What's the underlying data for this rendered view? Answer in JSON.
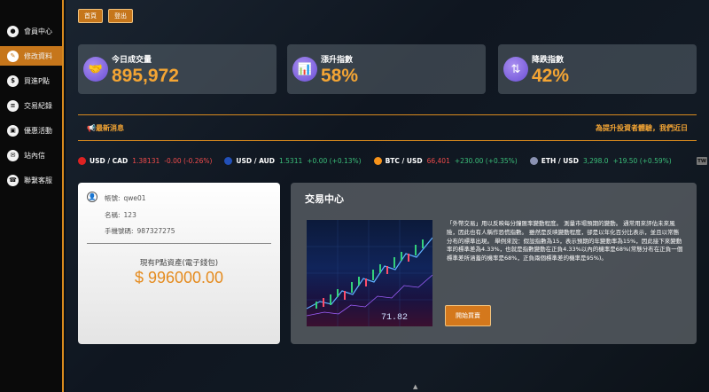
{
  "sidebar": {
    "items": [
      {
        "label": "會員中心",
        "icon": "user-icon",
        "glyph": "●",
        "active": false
      },
      {
        "label": "修改資料",
        "icon": "edit-user-icon",
        "glyph": "✎",
        "active": true
      },
      {
        "label": "買進P點",
        "icon": "dollar-icon",
        "glyph": "$",
        "active": false
      },
      {
        "label": "交易紀錄",
        "icon": "record-icon",
        "glyph": "≡",
        "active": false
      },
      {
        "label": "優惠活動",
        "icon": "gift-icon",
        "glyph": "▣",
        "active": false
      },
      {
        "label": "站內信",
        "icon": "mail-icon",
        "glyph": "✉",
        "active": false
      },
      {
        "label": "聯繫客服",
        "icon": "support-icon",
        "glyph": "☎",
        "active": false
      }
    ]
  },
  "topbar": {
    "home_label": "首頁",
    "logout_label": "登出"
  },
  "stats": [
    {
      "label": "今日成交量",
      "value": "895,972",
      "icon": "handshake-icon",
      "glyph": "🤝"
    },
    {
      "label": "漲升指數",
      "value": "58%",
      "icon": "chart-up-icon",
      "glyph": "📊"
    },
    {
      "label": "降跌指數",
      "value": "42%",
      "icon": "arrows-updown-icon",
      "glyph": "⇅"
    }
  ],
  "news": {
    "label": "📢最新消息",
    "marquee": "為提升投資者體驗，我們近日"
  },
  "ticker": [
    {
      "pair": "USD / CAD",
      "price": "1.38131",
      "change": "-0.00 (-0.26%)",
      "dir": "down",
      "flag_color": "#d22"
    },
    {
      "pair": "USD / AUD",
      "price": "1.5311",
      "change": "+0.00 (+0.13%)",
      "dir": "up",
      "flag_color": "#2250b8"
    },
    {
      "pair": "BTC / USD",
      "price": "66,401",
      "change": "+230.00 (+0.35%)",
      "dir": "up",
      "price_dir": "down",
      "flag_color": "#f7931a"
    },
    {
      "pair": "ETH / USD",
      "price": "3,298.0",
      "change": "+19.50 (+0.59%)",
      "dir": "up",
      "flag_color": "#8a92b2"
    }
  ],
  "user": {
    "account_label": "帳號:",
    "account": "qwe01",
    "name_label": "名稱:",
    "name": "123",
    "phone_label": "手機號碼:",
    "phone": "987327275",
    "asset_label": "現有P點資產(電子錢包)",
    "asset_value": "$ 996000.00"
  },
  "trade": {
    "title": "交易中心",
    "description": "「外幣交易」用以反映每分鐘匯率變動程度。 測量市場預期的變動。 通常用來評估未來風險，因此也有人稱作恐慌指數。 雖然是反映變動程度，卻是以年化百分比表示，並且以常態分布的標準出現。 舉例來說：假設指數為15，表示預期的年變動率為15%，因此接下來變動率的標準差為4.33%，也就是指數變動在正負4.33%以內的機率是68%(常態分布在正負一個標準差所涵蓋的機率是68%，正負兩個標準差的機率是95%)。",
    "button_label": "開始買賣",
    "image_text": "71.82"
  },
  "tw_badge": "TW",
  "colors": {
    "accent": "#d98a1e",
    "value": "#f4a534",
    "up": "#3bbf7a",
    "down": "#f04b4b"
  }
}
